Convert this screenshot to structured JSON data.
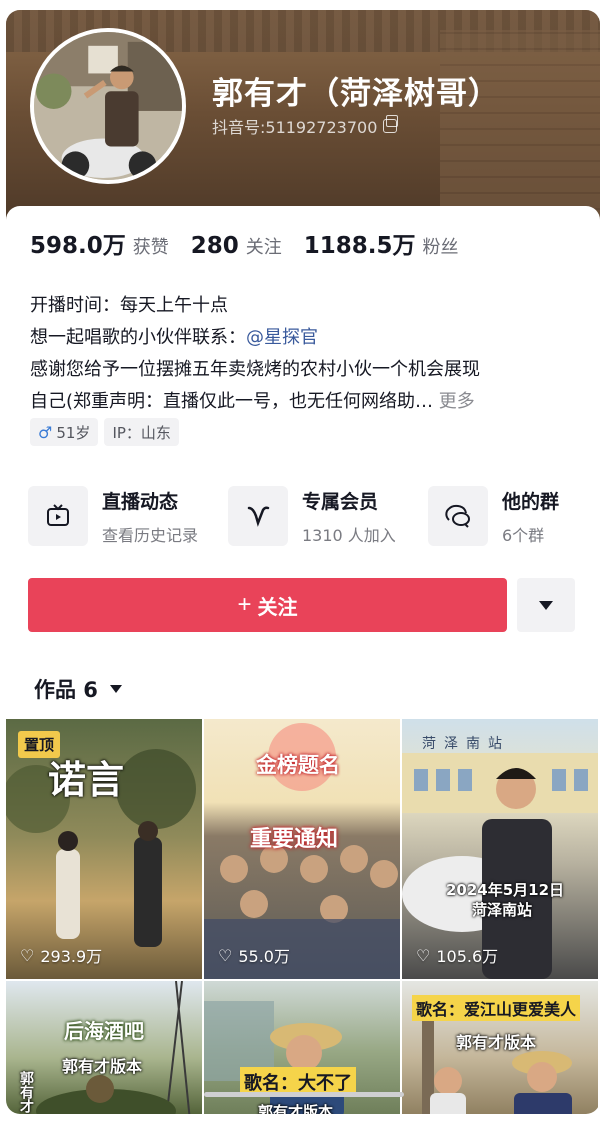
{
  "profile": {
    "nickname": "郭有才（菏泽树哥）",
    "douyin_id": "抖音号:51192723700"
  },
  "stats": [
    {
      "value": "598.0万",
      "label": "获赞"
    },
    {
      "value": "280",
      "label": "关注"
    },
    {
      "value": "1188.5万",
      "label": "粉丝"
    }
  ],
  "bio": {
    "line1": "开播时间：每天上午十点",
    "line2_prefix": "想一起唱歌的小伙伴联系：",
    "line2_mention": "@星探官",
    "line3": "感谢您给予一位摆摊五年卖烧烤的农村小伙一个机会展现",
    "line4": "自己(郑重声明：直播仅此一号，也无任何网络助…",
    "more": "更多"
  },
  "tags": {
    "age": "51岁",
    "ip": "IP：山东"
  },
  "features": [
    {
      "title": "直播动态",
      "sub": "查看历史记录",
      "icon": "tv-icon"
    },
    {
      "title": "专属会员",
      "sub": "1310 人加入",
      "icon": "v-icon"
    },
    {
      "title": "他的群",
      "sub": "6个群",
      "icon": "chat-icon"
    }
  ],
  "follow": {
    "label": "关注"
  },
  "works": {
    "label": "作品 6"
  },
  "videos": [
    {
      "pinned": "置顶",
      "likes": "293.9万",
      "title": "诺言"
    },
    {
      "likes": "55.0万",
      "title_top": "金榜题名",
      "title_mid": "重要通知"
    },
    {
      "likes": "105.6万",
      "title": "2024年5月12日",
      "subtitle": "菏泽南站",
      "sign": "菏泽南站"
    },
    {
      "title": "后海酒吧",
      "subtitle": "郭有才版本",
      "side": "郭有才"
    },
    {
      "title": "歌名：大不了",
      "subtitle": "郭有才版本"
    },
    {
      "title": "歌名：爱江山更爱美人",
      "subtitle": "郭有才版本"
    }
  ]
}
